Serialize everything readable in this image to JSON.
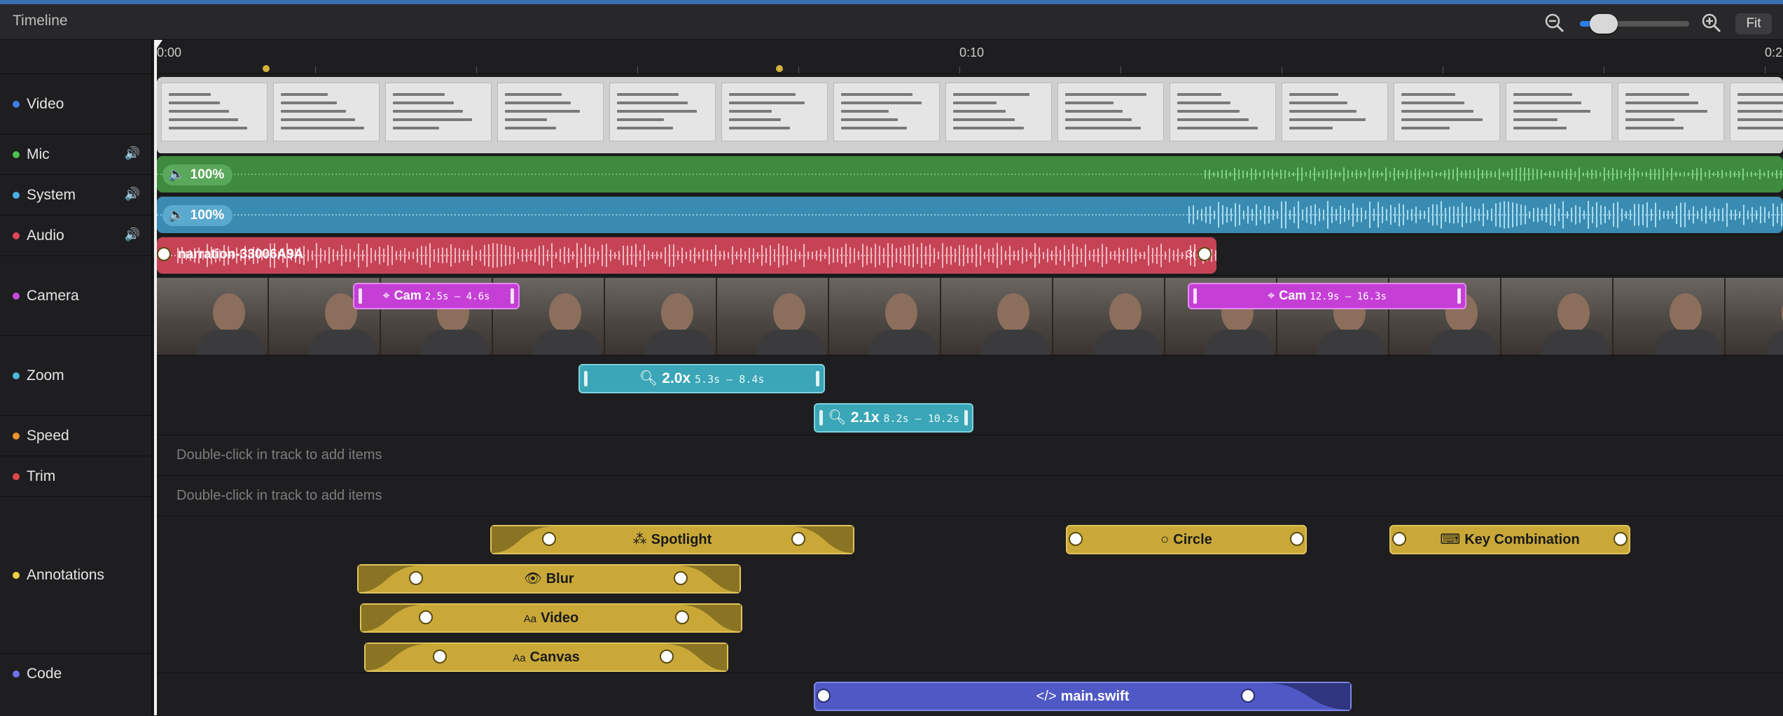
{
  "header": {
    "title": "Timeline",
    "zoom_out_icon": "zoom-out-icon",
    "zoom_in_icon": "zoom-in-icon",
    "fit_label": "Fit",
    "zoom_slider_value": 0.17
  },
  "ruler": {
    "labels": [
      "0:00",
      "0:10",
      "0:2"
    ]
  },
  "tracks": [
    {
      "label": "Video",
      "color": "#3d7ee8"
    },
    {
      "label": "Mic",
      "color": "#4fbf4f"
    },
    {
      "label": "System",
      "color": "#4ab0e0"
    },
    {
      "label": "Audio",
      "color": "#e04858"
    },
    {
      "label": "Camera",
      "color": "#c84ad8"
    },
    {
      "label": "Zoom",
      "color": "#4ab8d8"
    },
    {
      "label": "Speed",
      "color": "#f0922e"
    },
    {
      "label": "Trim",
      "color": "#e04848"
    },
    {
      "label": "Annotations",
      "color": "#f0d040"
    },
    {
      "label": "Code",
      "color": "#6c74e8"
    }
  ],
  "mic": {
    "volume": "100%"
  },
  "system": {
    "volume": "100%"
  },
  "audio": {
    "clip_name": "narration-33006A9A",
    "tail_label": "3("
  },
  "camera": {
    "markers": [
      {
        "label": "Cam",
        "range": "2.5s – 4.6s"
      },
      {
        "label": "Cam",
        "range": "12.9s – 16.3s"
      }
    ]
  },
  "zoom": {
    "items": [
      {
        "level": "2.0x",
        "range": "5.3s – 8.4s"
      },
      {
        "level": "2.1x",
        "range": "8.2s – 10.2s"
      }
    ]
  },
  "speed": {
    "hint": "Double-click in track to add items"
  },
  "trim": {
    "hint": "Double-click in track to add items"
  },
  "annotations": {
    "items": [
      {
        "label": "Spotlight"
      },
      {
        "label": "Circle"
      },
      {
        "label": "Key Combination"
      },
      {
        "label": "Blur"
      },
      {
        "label": "Video"
      },
      {
        "label": "Canvas"
      }
    ]
  },
  "code": {
    "items": [
      {
        "label": "main.swift"
      }
    ]
  }
}
